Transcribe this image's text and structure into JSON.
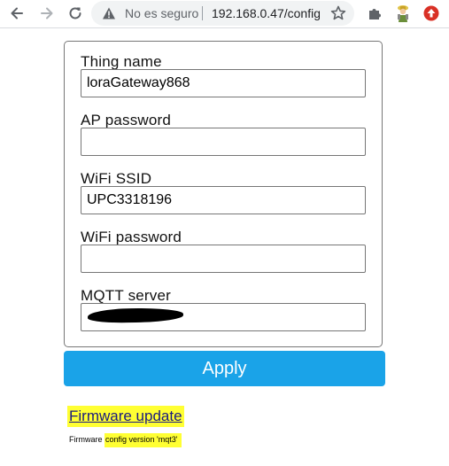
{
  "browser": {
    "security_label": "No es seguro",
    "url": "192.168.0.47/config"
  },
  "icons": {
    "back": "arrow-left-icon",
    "forward": "arrow-right-icon",
    "reload": "reload-icon",
    "warning": "warning-triangle-icon",
    "bookmark": "star-icon",
    "extensions": "puzzle-icon",
    "profile": "avatar-icon",
    "update": "update-arrow-icon"
  },
  "colors": {
    "apply_button": "#1aa3e8",
    "highlight": "#ffff33",
    "link": "#1a1a80"
  },
  "form": {
    "fields": [
      {
        "label": "Thing name",
        "value": "loraGateway868"
      },
      {
        "label": "AP password",
        "value": ""
      },
      {
        "label": "WiFi SSID",
        "value": "UPC3318196"
      },
      {
        "label": "WiFi password",
        "value": ""
      },
      {
        "label": "MQTT server",
        "value": ""
      }
    ],
    "apply_label": "Apply"
  },
  "footer": {
    "firmware_link": "Firmware update",
    "version_prefix": "Firmware",
    "version_text": "config version 'mqt3'"
  }
}
